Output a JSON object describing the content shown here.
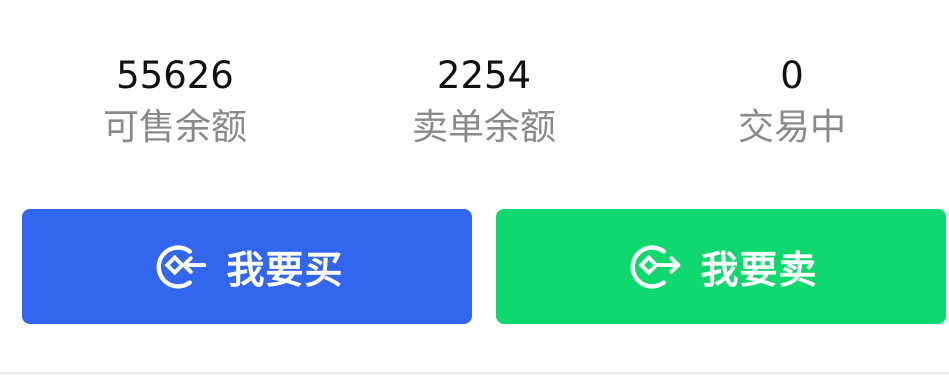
{
  "stats": [
    {
      "value": "55626",
      "label": "可售余额"
    },
    {
      "value": "2254",
      "label": "卖单余额"
    },
    {
      "value": "0",
      "label": "交易中"
    }
  ],
  "actions": {
    "buy": {
      "label": "我要买",
      "icon": "coin-arrow-in-icon",
      "color": "#3366EE"
    },
    "sell": {
      "label": "我要卖",
      "icon": "coin-arrow-out-icon",
      "color": "#0FD86E"
    }
  }
}
